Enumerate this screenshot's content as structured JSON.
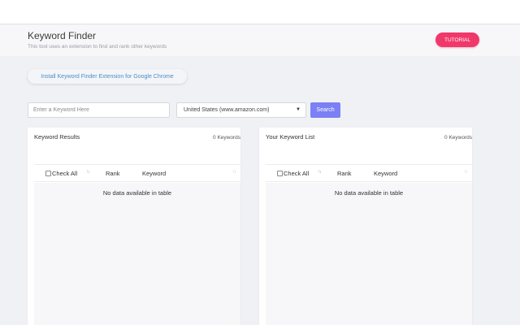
{
  "header": {
    "title": "Keyword Finder",
    "subtitle": "This tool uses an extension to find and rank other keywords",
    "tutorial_label": "TUTORIAL"
  },
  "install": {
    "label": "Install Keyword Finder Extension for Google Chrome"
  },
  "search": {
    "placeholder": "Enter a Keyword Here",
    "value": "",
    "country_selected": "United States (www.amazon.com)",
    "button_label": "Search"
  },
  "results_panel": {
    "title": "Keyword Results",
    "count": "0 Keywords",
    "columns": [
      "Check All",
      "Rank",
      "Keyword"
    ],
    "empty_message": "No data available in table"
  },
  "list_panel": {
    "title": "Your Keyword List",
    "count": "0 Keywords",
    "columns": [
      "Check All",
      "Rank",
      "Keyword"
    ],
    "empty_message": "No data available in table"
  },
  "icons": {
    "sort": "sort-icon",
    "dropdown": "chevron-down-icon"
  },
  "colors": {
    "tutorial": "#f0386b",
    "search_button": "#7b80f4",
    "link_text": "#4b8ec6"
  }
}
